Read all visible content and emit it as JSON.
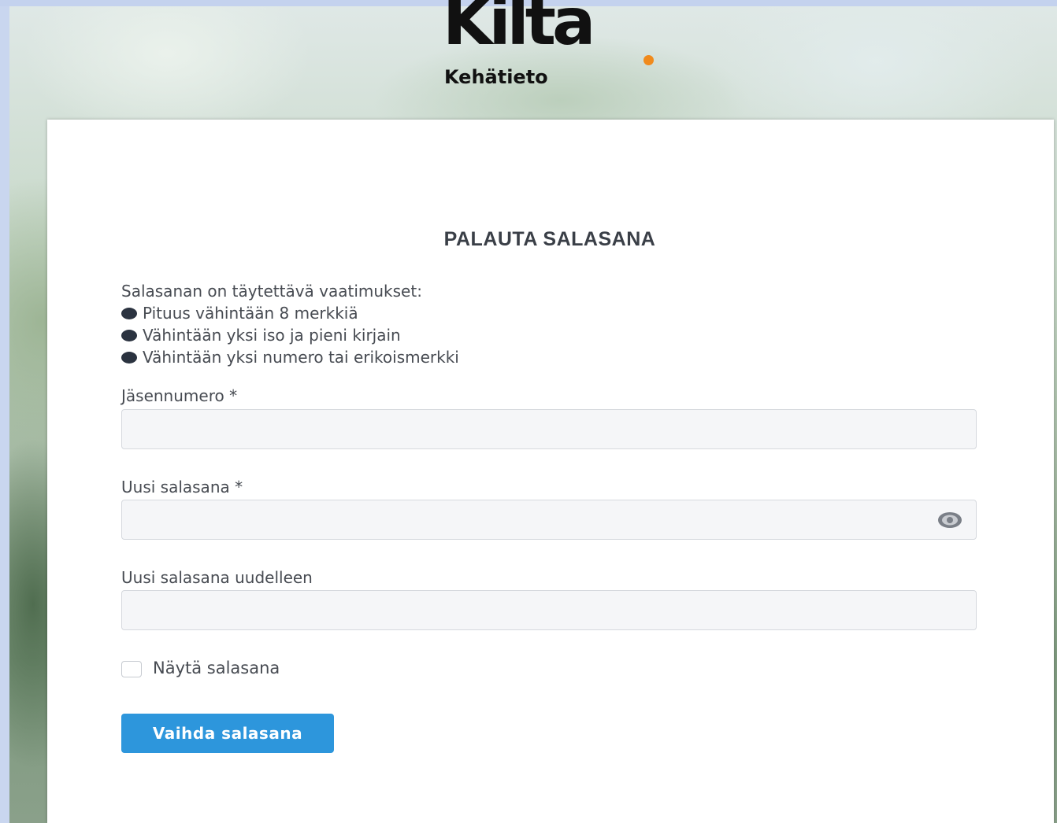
{
  "logo": {
    "wordmark": "Kilta",
    "subtitle": "Kehätieto",
    "dot_color": "#f08a1c"
  },
  "form": {
    "title": "PALAUTA SALASANA",
    "requirements_intro": "Salasanan on täytettävä vaatimukset:",
    "requirements": [
      "Pituus vähintään 8 merkkiä",
      "Vähintään yksi iso ja pieni kirjain",
      "Vähintään yksi numero tai erikoismerkki"
    ],
    "member_number": {
      "label": "Jäsennumero *",
      "value": "",
      "placeholder": ""
    },
    "new_password": {
      "label": "Uusi salasana *",
      "value": "",
      "placeholder": "",
      "toggle_icon": "eye-icon"
    },
    "new_password_again": {
      "label": "Uusi salasana uudelleen",
      "value": "",
      "placeholder": ""
    },
    "show_password": {
      "label": "Näytä salasana",
      "checked": false
    },
    "submit_label": "Vaihda salasana"
  },
  "colors": {
    "accent": "#2d96dc",
    "title": "#3a3f47",
    "text": "#474b52"
  }
}
